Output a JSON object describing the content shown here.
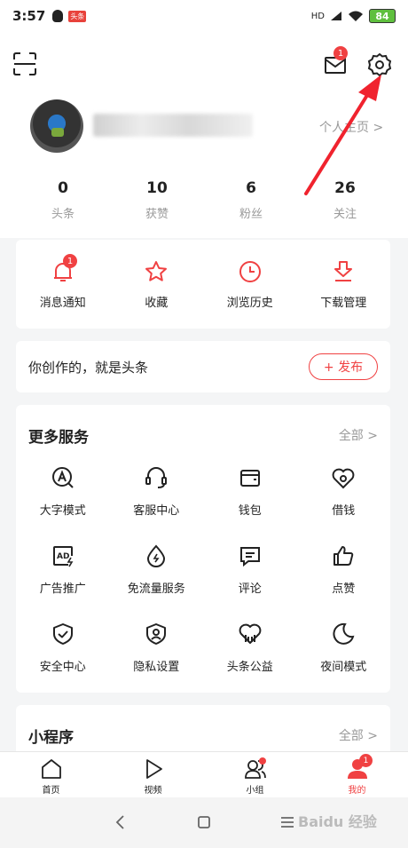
{
  "status_bar": {
    "time": "3:57",
    "app_badge": "头条",
    "signal": "HD",
    "battery": "84"
  },
  "header": {
    "homepage_link": "个人主页 >",
    "mail_badge": "1"
  },
  "stats": [
    {
      "value": "0",
      "label": "头条"
    },
    {
      "value": "10",
      "label": "获赞"
    },
    {
      "value": "6",
      "label": "粉丝"
    },
    {
      "value": "26",
      "label": "关注"
    }
  ],
  "quick_actions": [
    {
      "label": "消息通知",
      "icon": "bell-icon",
      "badge": "1"
    },
    {
      "label": "收藏",
      "icon": "star-icon"
    },
    {
      "label": "浏览历史",
      "icon": "clock-icon"
    },
    {
      "label": "下载管理",
      "icon": "download-icon"
    }
  ],
  "create": {
    "text": "你创作的，就是头条",
    "publish_label": "+ 发布"
  },
  "services": {
    "title": "更多服务",
    "all_label": "全部 >",
    "items": [
      {
        "label": "大字模式",
        "icon": "font-size-icon"
      },
      {
        "label": "客服中心",
        "icon": "headset-icon"
      },
      {
        "label": "钱包",
        "icon": "wallet-icon"
      },
      {
        "label": "借钱",
        "icon": "loan-icon"
      },
      {
        "label": "广告推广",
        "icon": "ad-icon"
      },
      {
        "label": "免流量服务",
        "icon": "drop-icon"
      },
      {
        "label": "评论",
        "icon": "comment-icon"
      },
      {
        "label": "点赞",
        "icon": "thumbs-up-icon"
      },
      {
        "label": "安全中心",
        "icon": "shield-check-icon"
      },
      {
        "label": "隐私设置",
        "icon": "privacy-icon"
      },
      {
        "label": "头条公益",
        "icon": "charity-icon"
      },
      {
        "label": "夜间模式",
        "icon": "moon-icon"
      }
    ]
  },
  "mini_programs": {
    "title": "小程序",
    "all_label": "全部 >"
  },
  "tabs": [
    {
      "label": "首页",
      "icon": "home-icon"
    },
    {
      "label": "视频",
      "icon": "play-icon"
    },
    {
      "label": "小组",
      "icon": "group-icon"
    },
    {
      "label": "我的",
      "icon": "user-icon",
      "badge": "1"
    }
  ],
  "watermark": "Baidu 经验",
  "colors": {
    "accent": "#f04142",
    "muted": "#999999"
  }
}
